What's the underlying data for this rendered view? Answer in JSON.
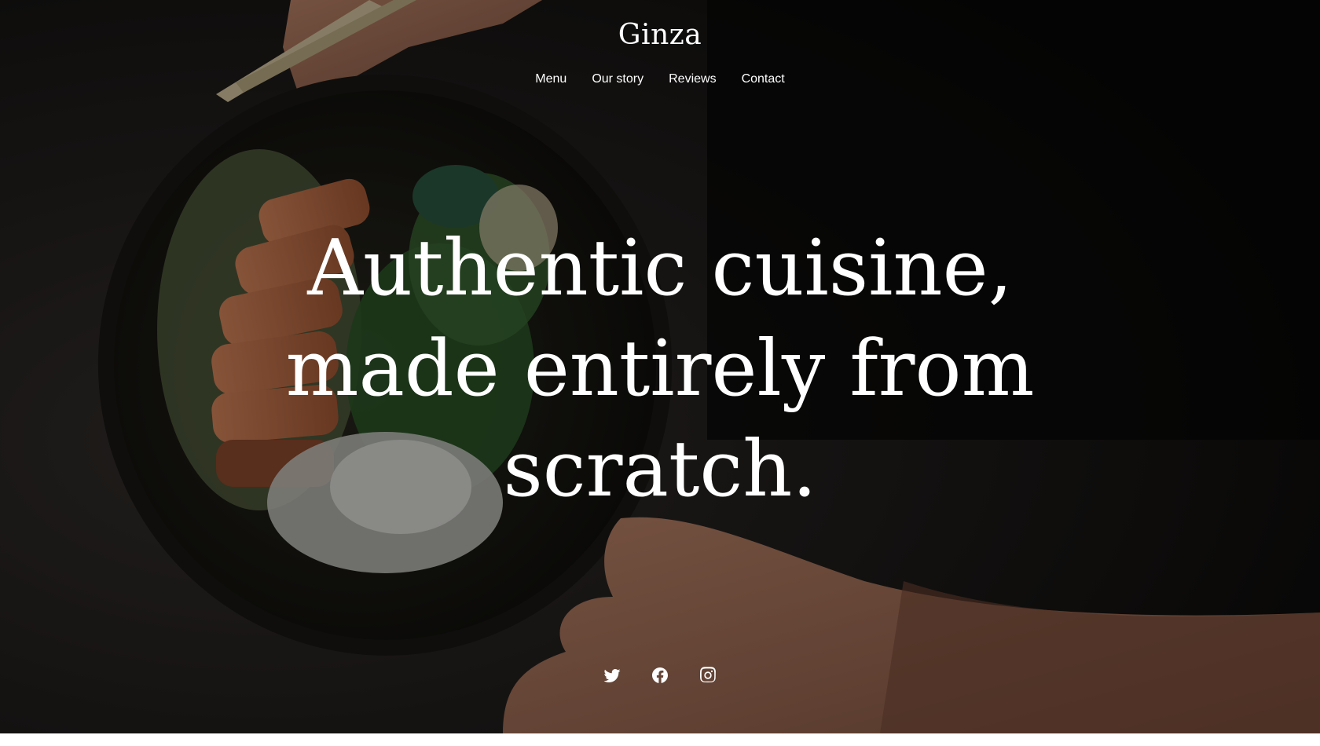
{
  "site": {
    "brand": "Ginza"
  },
  "nav": {
    "items": [
      {
        "label": "Menu"
      },
      {
        "label": "Our story"
      },
      {
        "label": "Reviews"
      },
      {
        "label": "Contact"
      }
    ]
  },
  "hero": {
    "headline_line1": "Authentic cuisine,",
    "headline_line2": "made entirely from",
    "headline_line3": "scratch."
  },
  "social": {
    "icons": [
      "twitter-icon",
      "facebook-icon",
      "instagram-icon"
    ]
  },
  "colors": {
    "text": "#ffffff",
    "background": "#0b0a0a"
  }
}
